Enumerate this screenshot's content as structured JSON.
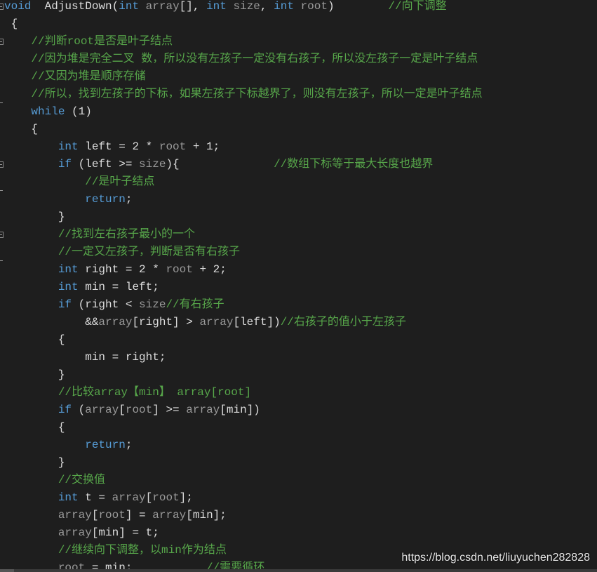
{
  "colors": {
    "background": "#1e1e1e",
    "keyword": "#569cd6",
    "comment": "#57a64a",
    "parameter": "#9a9a9a",
    "text": "#dcdcdc"
  },
  "fold_markers": {
    "collapse": [
      0,
      2,
      9,
      13
    ],
    "end": [
      5,
      10,
      14
    ]
  },
  "watermark": "https://blog.csdn.net/liuyuchen282828",
  "lines": [
    [
      [
        "k",
        "void"
      ],
      [
        "t",
        "  AdjustDown("
      ],
      [
        "k",
        "int"
      ],
      [
        "t",
        " "
      ],
      [
        "p",
        "array"
      ],
      [
        "t",
        "[], "
      ],
      [
        "k",
        "int"
      ],
      [
        "t",
        " "
      ],
      [
        "p",
        "size"
      ],
      [
        "t",
        ", "
      ],
      [
        "k",
        "int"
      ],
      [
        "t",
        " "
      ],
      [
        "p",
        "root"
      ],
      [
        "t",
        ")"
      ],
      [
        "t",
        "        "
      ],
      [
        "c",
        "//向下调整"
      ]
    ],
    [
      [
        "t",
        " {"
      ]
    ],
    [
      [
        "t",
        "    "
      ],
      [
        "c",
        "//判断root是否是叶子结点"
      ]
    ],
    [
      [
        "t",
        "    "
      ],
      [
        "c",
        "//因为堆是完全二叉 数，所以没有左孩子一定没有右孩子，所以没左孩子一定是叶子结点"
      ]
    ],
    [
      [
        "t",
        "    "
      ],
      [
        "c",
        "//又因为堆是顺序存储"
      ]
    ],
    [
      [
        "t",
        "    "
      ],
      [
        "c",
        "//所以，找到左孩子的下标，如果左孩子下标越界了，则没有左孩子，所以一定是叶子结点"
      ]
    ],
    [
      [
        "t",
        "    "
      ],
      [
        "k",
        "while"
      ],
      [
        "t",
        " (1)"
      ]
    ],
    [
      [
        "t",
        "    {"
      ]
    ],
    [
      [
        "t",
        "        "
      ],
      [
        "k",
        "int"
      ],
      [
        "t",
        " left = 2 * "
      ],
      [
        "p",
        "root"
      ],
      [
        "t",
        " + 1;"
      ]
    ],
    [
      [
        "t",
        "        "
      ],
      [
        "k",
        "if"
      ],
      [
        "t",
        " (left >= "
      ],
      [
        "p",
        "size"
      ],
      [
        "t",
        "){              "
      ],
      [
        "c",
        "//数组下标等于最大长度也越界"
      ]
    ],
    [
      [
        "t",
        "            "
      ],
      [
        "c",
        "//是叶子结点"
      ]
    ],
    [
      [
        "t",
        "            "
      ],
      [
        "k",
        "return"
      ],
      [
        "t",
        ";"
      ]
    ],
    [
      [
        "t",
        "        }"
      ]
    ],
    [
      [
        "t",
        "        "
      ],
      [
        "c",
        "//找到左右孩子最小的一个"
      ]
    ],
    [
      [
        "t",
        "        "
      ],
      [
        "c",
        "//一定又左孩子，判断是否有右孩子"
      ]
    ],
    [
      [
        "t",
        "        "
      ],
      [
        "k",
        "int"
      ],
      [
        "t",
        " right = 2 * "
      ],
      [
        "p",
        "root"
      ],
      [
        "t",
        " + 2;"
      ]
    ],
    [
      [
        "t",
        "        "
      ],
      [
        "k",
        "int"
      ],
      [
        "t",
        " min = left;"
      ]
    ],
    [
      [
        "t",
        "        "
      ],
      [
        "k",
        "if"
      ],
      [
        "t",
        " (right < "
      ],
      [
        "p",
        "size"
      ],
      [
        "c",
        "//有右孩子"
      ]
    ],
    [
      [
        "t",
        "            &&"
      ],
      [
        "p",
        "array"
      ],
      [
        "t",
        "[right] > "
      ],
      [
        "p",
        "array"
      ],
      [
        "t",
        "[left])"
      ],
      [
        "c",
        "//右孩子的值小于左孩子"
      ]
    ],
    [
      [
        "t",
        "        {"
      ]
    ],
    [
      [
        "t",
        "            min = right;"
      ]
    ],
    [
      [
        "t",
        "        }"
      ]
    ],
    [
      [
        "t",
        "        "
      ],
      [
        "c",
        "//比较array【min】 array[root]"
      ]
    ],
    [
      [
        "t",
        "        "
      ],
      [
        "k",
        "if"
      ],
      [
        "t",
        " ("
      ],
      [
        "p",
        "array"
      ],
      [
        "t",
        "["
      ],
      [
        "p",
        "root"
      ],
      [
        "t",
        "] >= "
      ],
      [
        "p",
        "array"
      ],
      [
        "t",
        "[min])"
      ]
    ],
    [
      [
        "t",
        "        {"
      ]
    ],
    [
      [
        "t",
        "            "
      ],
      [
        "k",
        "return"
      ],
      [
        "t",
        ";"
      ]
    ],
    [
      [
        "t",
        "        }"
      ]
    ],
    [
      [
        "t",
        "        "
      ],
      [
        "c",
        "//交换值"
      ]
    ],
    [
      [
        "t",
        "        "
      ],
      [
        "k",
        "int"
      ],
      [
        "t",
        " t = "
      ],
      [
        "p",
        "array"
      ],
      [
        "t",
        "["
      ],
      [
        "p",
        "root"
      ],
      [
        "t",
        "];"
      ]
    ],
    [
      [
        "t",
        "        "
      ],
      [
        "p",
        "array"
      ],
      [
        "t",
        "["
      ],
      [
        "p",
        "root"
      ],
      [
        "t",
        "] = "
      ],
      [
        "p",
        "array"
      ],
      [
        "t",
        "[min];"
      ]
    ],
    [
      [
        "t",
        "        "
      ],
      [
        "p",
        "array"
      ],
      [
        "t",
        "[min] = t;"
      ]
    ],
    [
      [
        "t",
        "        "
      ],
      [
        "c",
        "//继续向下调整，以min作为结点"
      ]
    ],
    [
      [
        "t",
        "        "
      ],
      [
        "p",
        "root"
      ],
      [
        "t",
        " = min;           "
      ],
      [
        "c",
        "//需要循环"
      ]
    ]
  ]
}
